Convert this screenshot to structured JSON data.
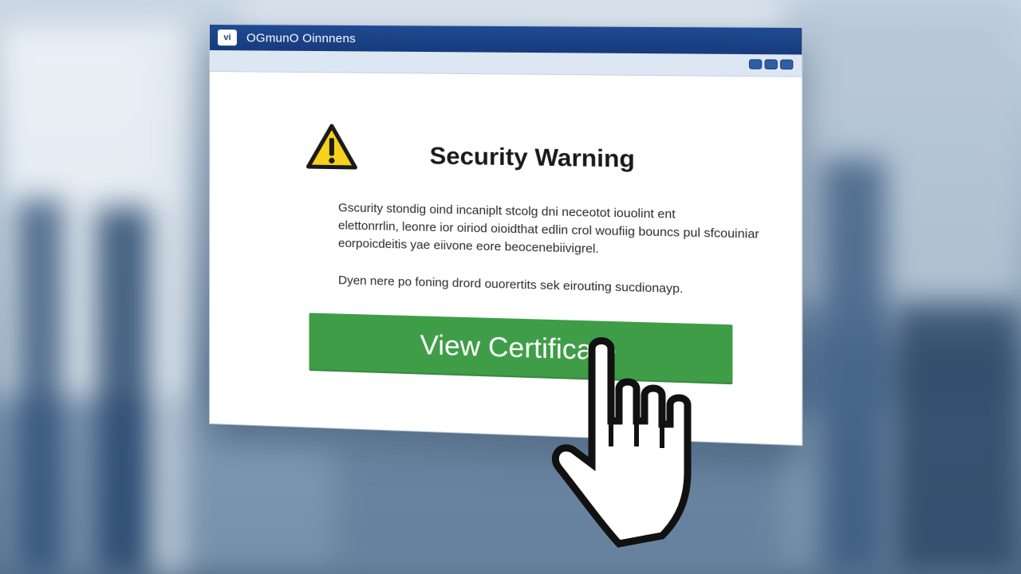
{
  "window": {
    "title": "OGmunO Oinnnens",
    "app_icon_text": "vi"
  },
  "dialog": {
    "heading": "Security Warning",
    "body_lines": [
      "Gscurity stondig oind incaniplt stcolg dni neceotot iouolint ent",
      "elettonrrlin, leonre ior oiriod oioidthat edlin crol woufiig bouncs pul sfcouiniar",
      "eorpoicdeitis yae eiivone eore beocenebiivigrel."
    ],
    "secondary_text": "Dyen nere po foning drord ouorertits sek eirouting sucdionayp.",
    "primary_button_label": "View Certificate"
  },
  "icons": {
    "warning": "warning-triangle-icon",
    "cursor": "hand-pointer-cursor-icon"
  },
  "colors": {
    "titlebar": "#1f4a93",
    "button": "#3f9d48",
    "warning_yellow": "#f6d21c"
  }
}
